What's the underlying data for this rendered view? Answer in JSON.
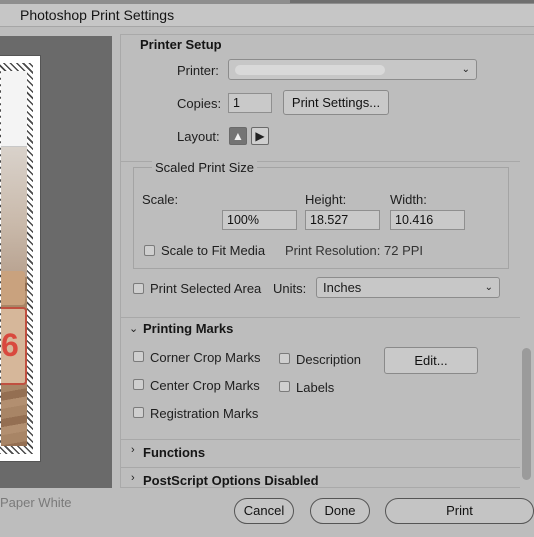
{
  "window": {
    "title": "Photoshop Print Settings"
  },
  "preview": {
    "paper_label": "Paper White",
    "photo_number": "6"
  },
  "printer_setup": {
    "title": "Printer Setup",
    "printer_label": "Printer:",
    "printer_value": "",
    "copies_label": "Copies:",
    "copies_value": "1",
    "print_settings_button": "Print Settings...",
    "layout_label": "Layout:",
    "layout_options": [
      "portrait",
      "landscape"
    ],
    "layout_selected": "portrait"
  },
  "scaled_print_size": {
    "title": "Scaled Print Size",
    "scale_label": "Scale:",
    "scale_value": "100%",
    "height_label": "Height:",
    "height_value": "18.527",
    "width_label": "Width:",
    "width_value": "10.416",
    "scale_to_fit_label": "Scale to Fit Media",
    "print_resolution": "Print Resolution: 72 PPI"
  },
  "print_selected_area_label": "Print Selected Area",
  "units": {
    "label": "Units:",
    "value": "Inches"
  },
  "printing_marks": {
    "title": "Printing Marks",
    "corner_crop_marks": "Corner Crop Marks",
    "center_crop_marks": "Center Crop Marks",
    "registration_marks": "Registration Marks",
    "description": "Description",
    "labels": "Labels",
    "edit_button": "Edit..."
  },
  "functions": {
    "title": "Functions"
  },
  "postscript": {
    "title": "PostScript Options Disabled"
  },
  "footer": {
    "cancel": "Cancel",
    "done": "Done",
    "print": "Print"
  }
}
